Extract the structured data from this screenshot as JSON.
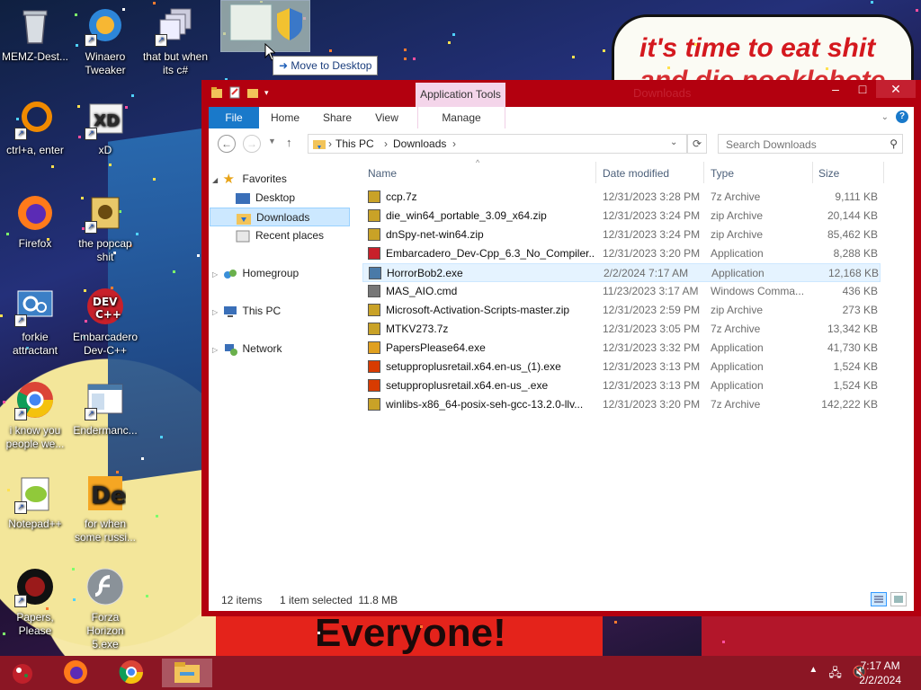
{
  "desktop": {
    "icons": [
      {
        "label": "MEMZ-Dest...",
        "icon": "recycle-bin-icon"
      },
      {
        "label": "Winaero Tweaker",
        "icon": "winaero-icon"
      },
      {
        "label": "that but when its c#",
        "icon": "windows-stack-icon"
      },
      {
        "label": "ctrl+a, enter",
        "icon": "orange-ring-icon"
      },
      {
        "label": "xD",
        "icon": "hxd-icon"
      },
      {
        "label": "Firefox",
        "icon": "firefox-icon"
      },
      {
        "label": "the popcap shit",
        "icon": "popcap-icon"
      },
      {
        "label": "forkie attractant",
        "icon": "gear-screen-icon"
      },
      {
        "label": "Embarcadero Dev-C++",
        "icon": "devcpp-icon"
      },
      {
        "label": "i know you people we...",
        "icon": "chrome-icon"
      },
      {
        "label": "Endermanc...",
        "icon": "app-window-icon"
      },
      {
        "label": "Notepad++",
        "icon": "notepadpp-icon"
      },
      {
        "label": "for when some russi...",
        "icon": "de-icon"
      },
      {
        "label": "Papers, Please",
        "icon": "papers-please-icon"
      },
      {
        "label": "Forza Horizon 5.exe",
        "icon": "flash-icon"
      }
    ],
    "wallpaper_text_1": "it's time to eat shit",
    "wallpaper_text_2": "and die nooklebote",
    "wallpaper_banner": "Everyone!",
    "drag_tooltip": "Move to Desktop"
  },
  "window": {
    "title": "Downloads",
    "context_tab": "Application Tools",
    "ribbon_tabs": [
      "File",
      "Home",
      "Share",
      "View",
      "Manage"
    ],
    "address": {
      "root": "This PC",
      "folder": "Downloads"
    },
    "search_placeholder": "Search Downloads",
    "nav": {
      "favorites": "Favorites",
      "desktop": "Desktop",
      "downloads": "Downloads",
      "recent": "Recent places",
      "homegroup": "Homegroup",
      "thispc": "This PC",
      "network": "Network"
    },
    "columns": {
      "name": "Name",
      "date": "Date modified",
      "type": "Type",
      "size": "Size"
    },
    "files": [
      {
        "name": "ccp.7z",
        "date": "12/31/2023 3:28 PM",
        "type": "7z Archive",
        "size": "9,111 KB",
        "icon": "archive-icon",
        "color": "#c9a227"
      },
      {
        "name": "die_win64_portable_3.09_x64.zip",
        "date": "12/31/2023 3:24 PM",
        "type": "zip Archive",
        "size": "20,144 KB",
        "icon": "archive-icon",
        "color": "#c9a227"
      },
      {
        "name": "dnSpy-net-win64.zip",
        "date": "12/31/2023 3:24 PM",
        "type": "zip Archive",
        "size": "85,462 KB",
        "icon": "archive-icon",
        "color": "#c9a227"
      },
      {
        "name": "Embarcadero_Dev-Cpp_6.3_No_Compiler...",
        "date": "12/31/2023 3:20 PM",
        "type": "Application",
        "size": "8,288 KB",
        "icon": "devcpp-icon",
        "color": "#c8202a"
      },
      {
        "name": "HorrorBob2.exe",
        "date": "2/2/2024 7:17 AM",
        "type": "Application",
        "size": "12,168 KB",
        "icon": "exe-icon",
        "color": "#4a7aa8"
      },
      {
        "name": "MAS_AIO.cmd",
        "date": "11/23/2023 3:17 AM",
        "type": "Windows Comma...",
        "size": "436 KB",
        "icon": "cmd-icon",
        "color": "#777777"
      },
      {
        "name": "Microsoft-Activation-Scripts-master.zip",
        "date": "12/31/2023 2:59 PM",
        "type": "zip Archive",
        "size": "273 KB",
        "icon": "archive-icon",
        "color": "#c9a227"
      },
      {
        "name": "MTKV273.7z",
        "date": "12/31/2023 3:05 PM",
        "type": "7z Archive",
        "size": "13,342 KB",
        "icon": "archive-icon",
        "color": "#c9a227"
      },
      {
        "name": "PapersPlease64.exe",
        "date": "12/31/2023 3:32 PM",
        "type": "Application",
        "size": "41,730 KB",
        "icon": "papers-please-icon",
        "color": "#e0a020"
      },
      {
        "name": "setupproplusretail.x64.en-us_(1).exe",
        "date": "12/31/2023 3:13 PM",
        "type": "Application",
        "size": "1,524 KB",
        "icon": "office-icon",
        "color": "#d83b01"
      },
      {
        "name": "setupproplusretail.x64.en-us_.exe",
        "date": "12/31/2023 3:13 PM",
        "type": "Application",
        "size": "1,524 KB",
        "icon": "office-icon",
        "color": "#d83b01"
      },
      {
        "name": "winlibs-x86_64-posix-seh-gcc-13.2.0-llv...",
        "date": "12/31/2023 3:20 PM",
        "type": "7z Archive",
        "size": "142,222 KB",
        "icon": "archive-icon",
        "color": "#c9a227"
      }
    ],
    "status": {
      "count": "12 items",
      "selected": "1 item selected  11.8 MB"
    }
  },
  "taskbar": {
    "time": "7:17 AM",
    "date": "2/2/2024",
    "accent": "#8b1624"
  }
}
